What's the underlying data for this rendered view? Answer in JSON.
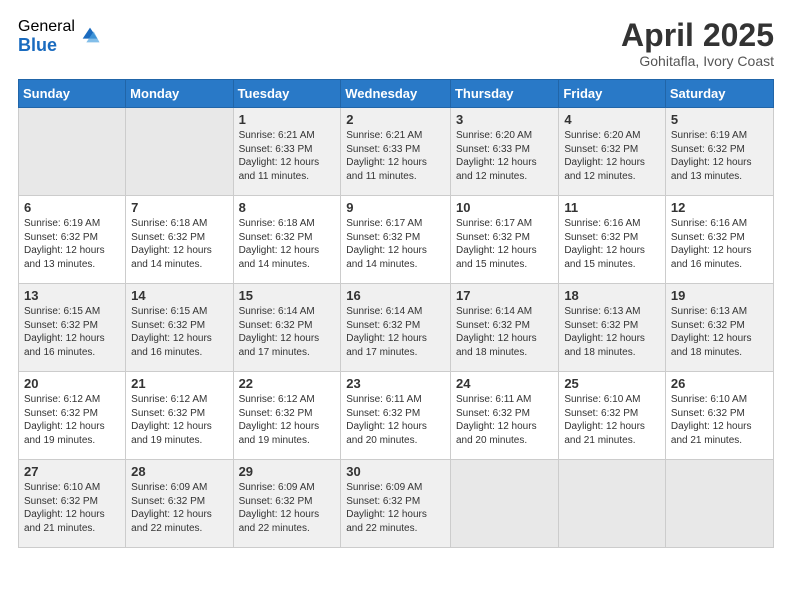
{
  "logo": {
    "general": "General",
    "blue": "Blue"
  },
  "header": {
    "month": "April 2025",
    "location": "Gohitafla, Ivory Coast"
  },
  "weekdays": [
    "Sunday",
    "Monday",
    "Tuesday",
    "Wednesday",
    "Thursday",
    "Friday",
    "Saturday"
  ],
  "weeks": [
    [
      {
        "day": "",
        "info": ""
      },
      {
        "day": "",
        "info": ""
      },
      {
        "day": "1",
        "info": "Sunrise: 6:21 AM\nSunset: 6:33 PM\nDaylight: 12 hours\nand 11 minutes."
      },
      {
        "day": "2",
        "info": "Sunrise: 6:21 AM\nSunset: 6:33 PM\nDaylight: 12 hours\nand 11 minutes."
      },
      {
        "day": "3",
        "info": "Sunrise: 6:20 AM\nSunset: 6:33 PM\nDaylight: 12 hours\nand 12 minutes."
      },
      {
        "day": "4",
        "info": "Sunrise: 6:20 AM\nSunset: 6:32 PM\nDaylight: 12 hours\nand 12 minutes."
      },
      {
        "day": "5",
        "info": "Sunrise: 6:19 AM\nSunset: 6:32 PM\nDaylight: 12 hours\nand 13 minutes."
      }
    ],
    [
      {
        "day": "6",
        "info": "Sunrise: 6:19 AM\nSunset: 6:32 PM\nDaylight: 12 hours\nand 13 minutes."
      },
      {
        "day": "7",
        "info": "Sunrise: 6:18 AM\nSunset: 6:32 PM\nDaylight: 12 hours\nand 14 minutes."
      },
      {
        "day": "8",
        "info": "Sunrise: 6:18 AM\nSunset: 6:32 PM\nDaylight: 12 hours\nand 14 minutes."
      },
      {
        "day": "9",
        "info": "Sunrise: 6:17 AM\nSunset: 6:32 PM\nDaylight: 12 hours\nand 14 minutes."
      },
      {
        "day": "10",
        "info": "Sunrise: 6:17 AM\nSunset: 6:32 PM\nDaylight: 12 hours\nand 15 minutes."
      },
      {
        "day": "11",
        "info": "Sunrise: 6:16 AM\nSunset: 6:32 PM\nDaylight: 12 hours\nand 15 minutes."
      },
      {
        "day": "12",
        "info": "Sunrise: 6:16 AM\nSunset: 6:32 PM\nDaylight: 12 hours\nand 16 minutes."
      }
    ],
    [
      {
        "day": "13",
        "info": "Sunrise: 6:15 AM\nSunset: 6:32 PM\nDaylight: 12 hours\nand 16 minutes."
      },
      {
        "day": "14",
        "info": "Sunrise: 6:15 AM\nSunset: 6:32 PM\nDaylight: 12 hours\nand 16 minutes."
      },
      {
        "day": "15",
        "info": "Sunrise: 6:14 AM\nSunset: 6:32 PM\nDaylight: 12 hours\nand 17 minutes."
      },
      {
        "day": "16",
        "info": "Sunrise: 6:14 AM\nSunset: 6:32 PM\nDaylight: 12 hours\nand 17 minutes."
      },
      {
        "day": "17",
        "info": "Sunrise: 6:14 AM\nSunset: 6:32 PM\nDaylight: 12 hours\nand 18 minutes."
      },
      {
        "day": "18",
        "info": "Sunrise: 6:13 AM\nSunset: 6:32 PM\nDaylight: 12 hours\nand 18 minutes."
      },
      {
        "day": "19",
        "info": "Sunrise: 6:13 AM\nSunset: 6:32 PM\nDaylight: 12 hours\nand 18 minutes."
      }
    ],
    [
      {
        "day": "20",
        "info": "Sunrise: 6:12 AM\nSunset: 6:32 PM\nDaylight: 12 hours\nand 19 minutes."
      },
      {
        "day": "21",
        "info": "Sunrise: 6:12 AM\nSunset: 6:32 PM\nDaylight: 12 hours\nand 19 minutes."
      },
      {
        "day": "22",
        "info": "Sunrise: 6:12 AM\nSunset: 6:32 PM\nDaylight: 12 hours\nand 19 minutes."
      },
      {
        "day": "23",
        "info": "Sunrise: 6:11 AM\nSunset: 6:32 PM\nDaylight: 12 hours\nand 20 minutes."
      },
      {
        "day": "24",
        "info": "Sunrise: 6:11 AM\nSunset: 6:32 PM\nDaylight: 12 hours\nand 20 minutes."
      },
      {
        "day": "25",
        "info": "Sunrise: 6:10 AM\nSunset: 6:32 PM\nDaylight: 12 hours\nand 21 minutes."
      },
      {
        "day": "26",
        "info": "Sunrise: 6:10 AM\nSunset: 6:32 PM\nDaylight: 12 hours\nand 21 minutes."
      }
    ],
    [
      {
        "day": "27",
        "info": "Sunrise: 6:10 AM\nSunset: 6:32 PM\nDaylight: 12 hours\nand 21 minutes."
      },
      {
        "day": "28",
        "info": "Sunrise: 6:09 AM\nSunset: 6:32 PM\nDaylight: 12 hours\nand 22 minutes."
      },
      {
        "day": "29",
        "info": "Sunrise: 6:09 AM\nSunset: 6:32 PM\nDaylight: 12 hours\nand 22 minutes."
      },
      {
        "day": "30",
        "info": "Sunrise: 6:09 AM\nSunset: 6:32 PM\nDaylight: 12 hours\nand 22 minutes."
      },
      {
        "day": "",
        "info": ""
      },
      {
        "day": "",
        "info": ""
      },
      {
        "day": "",
        "info": ""
      }
    ]
  ]
}
